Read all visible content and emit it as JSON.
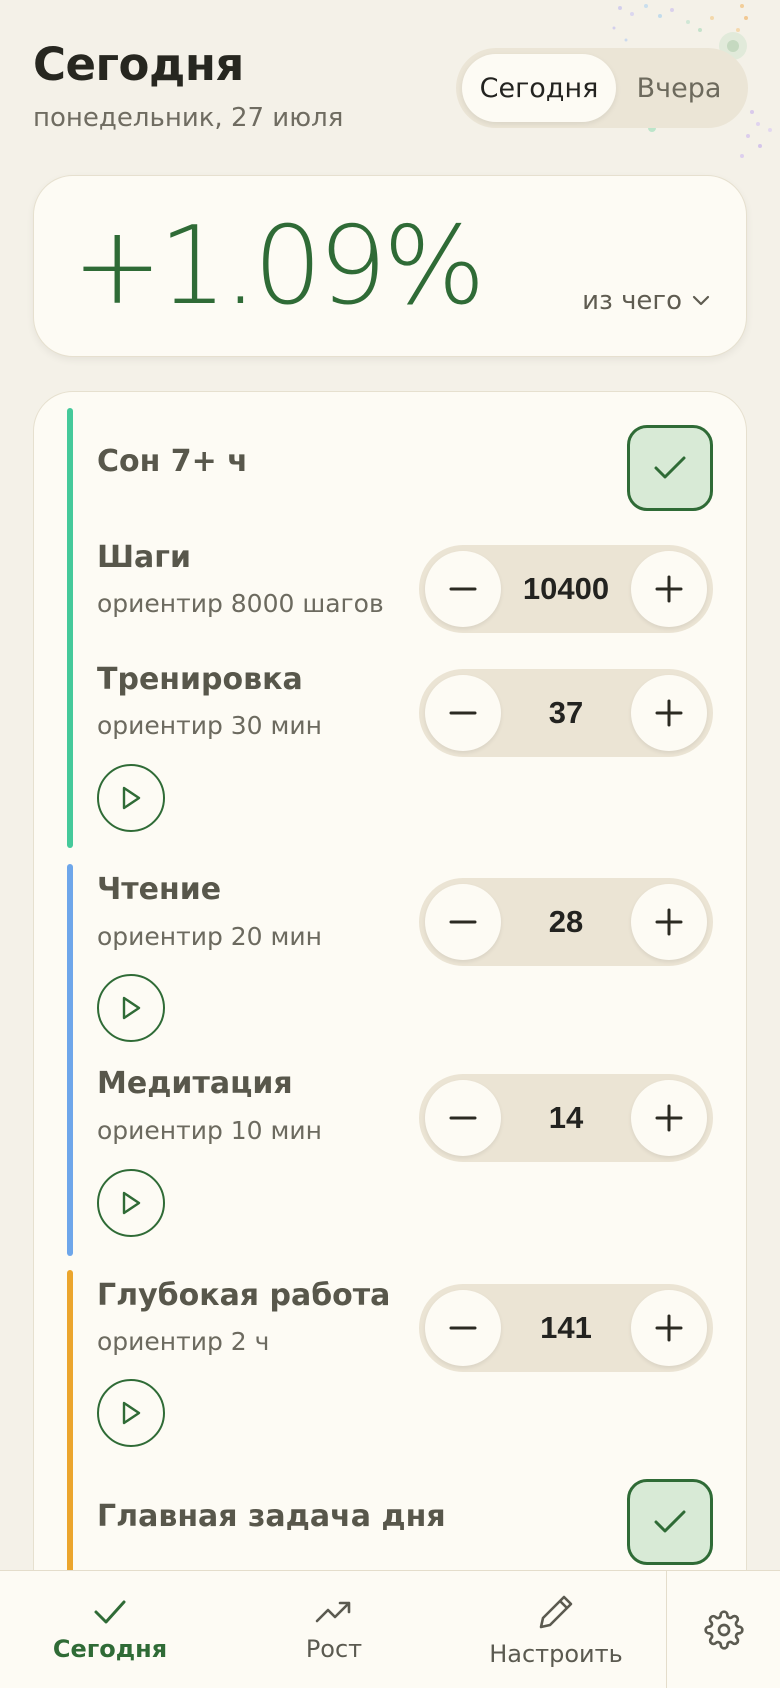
{
  "header": {
    "title": "Сегодня",
    "date": "понедельник, 27 июля"
  },
  "day_switch": {
    "options": [
      "Сегодня",
      "Вчера"
    ],
    "selected": "Сегодня"
  },
  "score": {
    "value": "+1.09%",
    "breakdown_label": "из чего"
  },
  "groups": [
    {
      "color": "#45c99a"
    },
    {
      "color": "#6ea6ea"
    },
    {
      "color": "#eba52d"
    }
  ],
  "habits": [
    {
      "name": "Сон 7+ ч",
      "type": "check",
      "done": true
    },
    {
      "name": "Шаги",
      "target": "ориентир 8000 шагов",
      "type": "counter",
      "value": "10400"
    },
    {
      "name": "Тренировка",
      "target": "ориентир 30 мин",
      "type": "counter",
      "value": "37",
      "timer": true
    },
    {
      "name": "Чтение",
      "target": "ориентир 20 мин",
      "type": "counter",
      "value": "28",
      "timer": true
    },
    {
      "name": "Медитация",
      "target": "ориентир 10 мин",
      "type": "counter",
      "value": "14",
      "timer": true
    },
    {
      "name": "Глубокая работа",
      "target": "ориентир 2 ч",
      "type": "counter",
      "value": "141",
      "timer": true
    },
    {
      "name": "Главная задача дня",
      "type": "check",
      "done": true
    }
  ],
  "nav": {
    "items": [
      {
        "label": "Сегодня",
        "icon": "check-icon",
        "active": true
      },
      {
        "label": "Рост",
        "icon": "trend-up-icon",
        "active": false
      },
      {
        "label": "Настроить",
        "icon": "pencil-icon",
        "active": false
      }
    ],
    "settings_icon": "gear-icon"
  },
  "colors": {
    "accent": "#2f6b36",
    "background": "#f4f1e8",
    "card": "#fdfbf4"
  }
}
